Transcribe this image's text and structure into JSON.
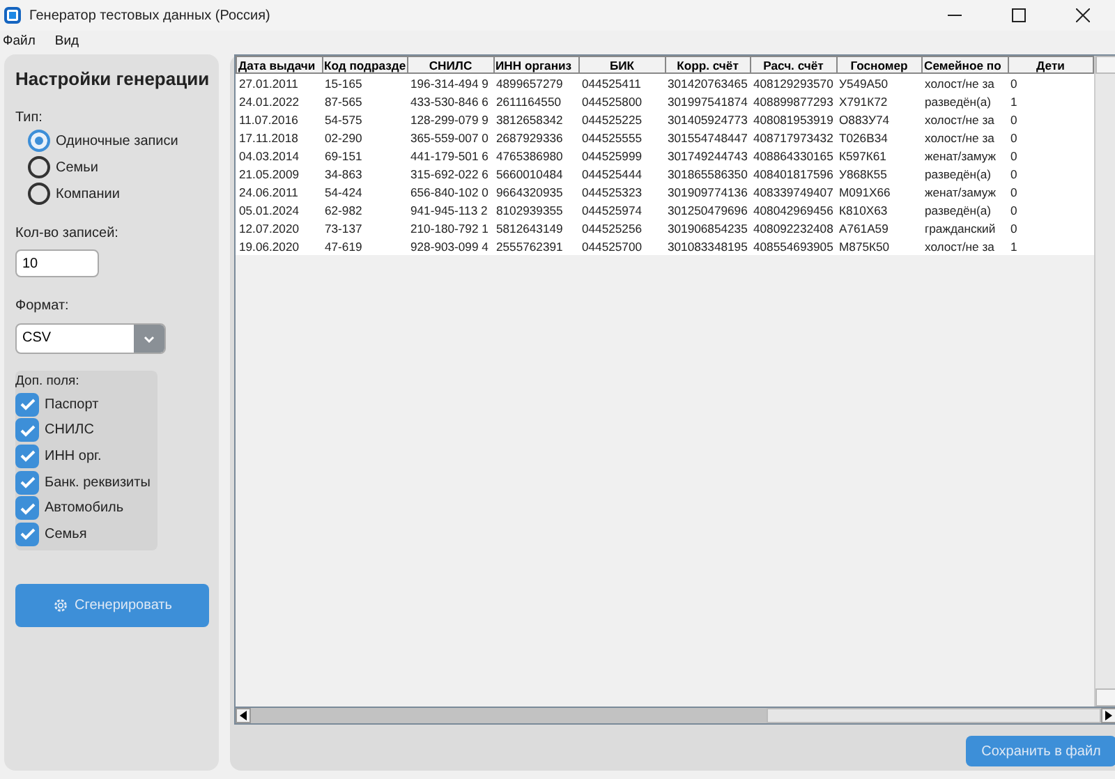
{
  "window": {
    "title": "Генератор тестовых данных (Россия)"
  },
  "menu": [
    "Файл",
    "Вид"
  ],
  "sidebar": {
    "title": "Настройки генерации",
    "type_label": "Тип:",
    "types": [
      {
        "label": "Одиночные записи",
        "selected": true
      },
      {
        "label": "Семьи",
        "selected": false
      },
      {
        "label": "Компании",
        "selected": false
      }
    ],
    "count_label": "Кол-во записей:",
    "count_value": "10",
    "format_label": "Формат:",
    "format_value": "CSV",
    "extra_label": "Доп. поля:",
    "extras": [
      {
        "label": "Паспорт",
        "checked": true
      },
      {
        "label": "СНИЛС",
        "checked": true
      },
      {
        "label": "ИНН орг.",
        "checked": true
      },
      {
        "label": "Банк. реквизиты",
        "checked": true
      },
      {
        "label": "Автомобиль",
        "checked": true
      },
      {
        "label": "Семья",
        "checked": true
      }
    ],
    "generate_button": "Сгенерировать"
  },
  "table": {
    "columns": [
      "Дата выдачи",
      "Код подразде",
      "СНИЛС",
      "ИНН организ",
      "БИК",
      "Корр. счёт",
      "Расч. счёт",
      "Госномер",
      "Семейное по",
      "Дети"
    ],
    "rows": [
      [
        "27.01.2011",
        "15-165",
        "196-314-494 9",
        "4899657279",
        "044525411",
        "301420763465",
        "408129293570",
        "У549А50",
        "холост/не за",
        "0"
      ],
      [
        "24.01.2022",
        "87-565",
        "433-530-846 6",
        "2611164550",
        "044525800",
        "301997541874",
        "408899877293",
        "Х791К72",
        "разведён(а)",
        "1"
      ],
      [
        "11.07.2016",
        "54-575",
        "128-299-079 9",
        "3812658342",
        "044525225",
        "301405924773",
        "408081953919",
        "О883У74",
        "холост/не за",
        "0"
      ],
      [
        "17.11.2018",
        "02-290",
        "365-559-007 0",
        "2687929336",
        "044525555",
        "301554748447",
        "408717973432",
        "Т026В34",
        "холост/не за",
        "0"
      ],
      [
        "04.03.2014",
        "69-151",
        "441-179-501 6",
        "4765386980",
        "044525999",
        "301749244743",
        "408864330165",
        "К597К61",
        "женат/замуж",
        "0"
      ],
      [
        "21.05.2009",
        "34-863",
        "315-692-022 6",
        "5660010484",
        "044525444",
        "301865586350",
        "408401817596",
        "У868К55",
        "разведён(а)",
        "0"
      ],
      [
        "24.06.2011",
        "54-424",
        "656-840-102 0",
        "9664320935",
        "044525323",
        "301909774136",
        "408339749407",
        "М091Х66",
        "женат/замуж",
        "0"
      ],
      [
        "05.01.2024",
        "62-982",
        "941-945-113 2",
        "8102939355",
        "044525974",
        "301250479696",
        "408042969456",
        "К810Х63",
        "разведён(а)",
        "0"
      ],
      [
        "12.07.2020",
        "73-137",
        "210-180-792 1",
        "5812643149",
        "044525256",
        "301906854235",
        "408092232408",
        "А761А59",
        "гражданский",
        "0"
      ],
      [
        "19.06.2020",
        "47-619",
        "928-903-099 4",
        "2555762391",
        "044525700",
        "301083348195",
        "408554693905",
        "М875К50",
        "холост/не за",
        "1"
      ]
    ]
  },
  "save_button": "Сохранить в файл"
}
